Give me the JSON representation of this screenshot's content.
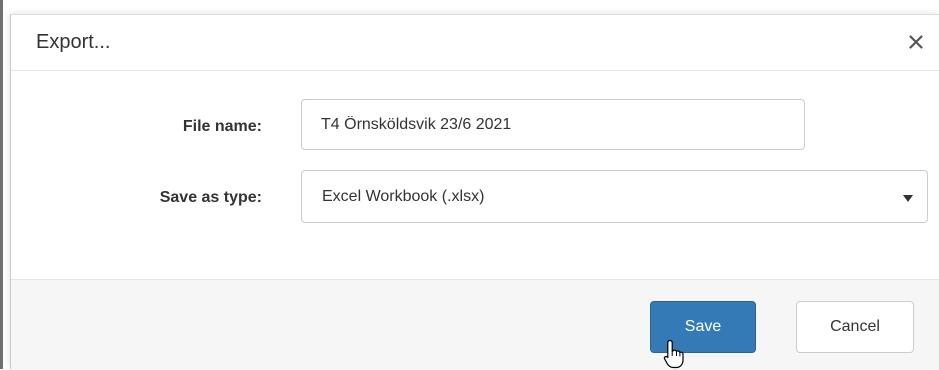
{
  "dialog": {
    "title": "Export...",
    "close_icon": "close-icon"
  },
  "form": {
    "file_name_label": "File name:",
    "file_name_value": "T4 Örnsköldsvik 23/6 2021",
    "save_as_type_label": "Save as type:",
    "save_as_type_value": "Excel Workbook (.xlsx)",
    "dropdown_icon": "caret-down-icon"
  },
  "footer": {
    "save_label": "Save",
    "cancel_label": "Cancel"
  },
  "colors": {
    "primary_button": "#337ab7",
    "text": "#333333",
    "border": "#cccccc"
  },
  "cursor": {
    "icon": "hand-pointer-icon"
  }
}
